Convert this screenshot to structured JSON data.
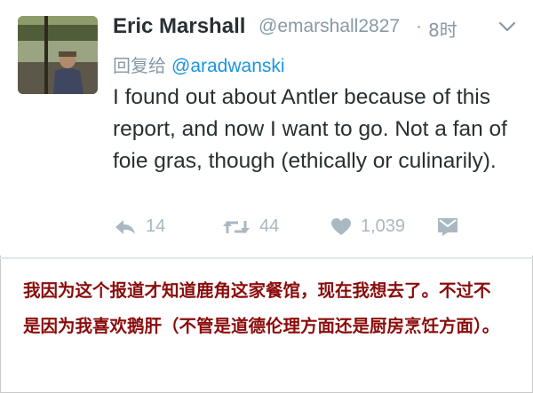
{
  "colors": {
    "name_text": "#292f33",
    "secondary_text": "#8899a6",
    "mention_link": "#1b95e0",
    "action_icon": "#aab8c2",
    "caption_text": "#8b0b0b"
  },
  "tweet": {
    "author_name": "Eric Marshall",
    "handle": "@emarshall2827",
    "separator": "·",
    "timestamp": "8时",
    "caret_icon": "chevron-down-icon",
    "reply_prefix": "回复给",
    "reply_mention": "@aradwanski",
    "text": "I found out about Antler because of this report, and now I want to go. Not a fan of foie gras, though (ethically or culinarily).",
    "actions": {
      "reply": {
        "icon": "reply-icon",
        "count": "14"
      },
      "retweet": {
        "icon": "retweet-icon",
        "count": "44"
      },
      "like": {
        "icon": "heart-icon",
        "count": "1,039"
      },
      "dm": {
        "icon": "direct-message-icon"
      }
    }
  },
  "caption": {
    "text": "我因为这个报道才知道鹿角这家餐馆，现在我想去了。不过不是因为我喜欢鹅肝（不管是道德伦理方面还是厨房烹饪方面）。"
  }
}
